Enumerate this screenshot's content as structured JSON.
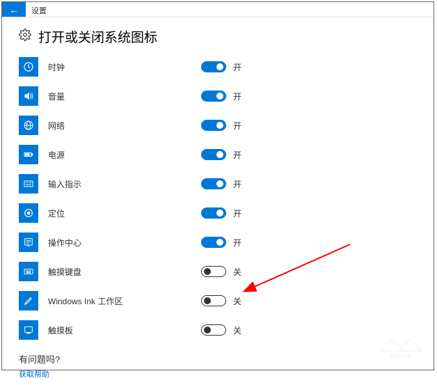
{
  "titlebar": {
    "back_glyph": "←",
    "title": "设置"
  },
  "page": {
    "title": "打开或关闭系统图标"
  },
  "settings": [
    {
      "icon": "clock",
      "label": "时钟",
      "on": true,
      "state_label": "开"
    },
    {
      "icon": "volume",
      "label": "音量",
      "on": true,
      "state_label": "开"
    },
    {
      "icon": "network",
      "label": "网络",
      "on": true,
      "state_label": "开"
    },
    {
      "icon": "power",
      "label": "电源",
      "on": true,
      "state_label": "开"
    },
    {
      "icon": "ime",
      "label": "输入指示",
      "on": true,
      "state_label": "开"
    },
    {
      "icon": "location",
      "label": "定位",
      "on": true,
      "state_label": "开"
    },
    {
      "icon": "action",
      "label": "操作中心",
      "on": true,
      "state_label": "开"
    },
    {
      "icon": "keyboard",
      "label": "触摸键盘",
      "on": false,
      "state_label": "关"
    },
    {
      "icon": "ink",
      "label": "Windows Ink 工作区",
      "on": false,
      "state_label": "关"
    },
    {
      "icon": "touchpad",
      "label": "触摸板",
      "on": false,
      "state_label": "关"
    }
  ],
  "footer": {
    "question": "有问题吗?",
    "help_link": "获取帮助"
  },
  "watermark": "系统之家"
}
